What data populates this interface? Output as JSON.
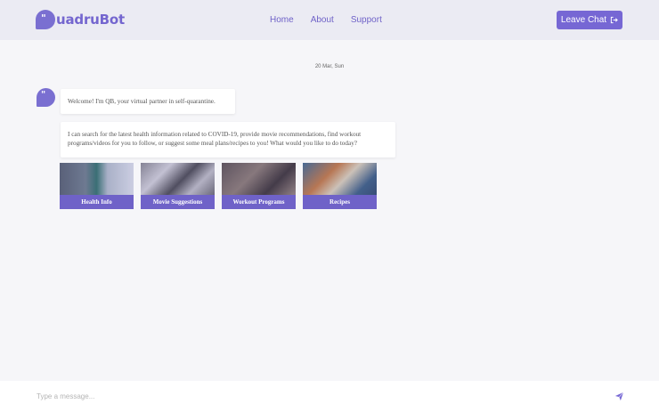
{
  "header": {
    "logo_text": "uadruBot",
    "logo_glyph": "\"",
    "nav": [
      {
        "label": "Home"
      },
      {
        "label": "About"
      },
      {
        "label": "Support"
      }
    ],
    "leave_label": "Leave Chat",
    "leave_icon": "logout-icon"
  },
  "chat": {
    "date": "20 Mar, Sun",
    "avatar_glyph": "\"",
    "messages": [
      {
        "text": "Welcome! I'm QB, your virtual partner in self-quarantine."
      },
      {
        "text": "I can search for the latest health information related to COVID-19, provide movie recommendations, find workout programs/videos for you to follow, or suggest some meal plans/recipes to you! What would you like to do today?"
      }
    ],
    "options": [
      {
        "label": "Health Info"
      },
      {
        "label": "Movie Suggestions"
      },
      {
        "label": "Workout Programs"
      },
      {
        "label": "Recipes"
      }
    ]
  },
  "composer": {
    "placeholder": "Type a message...",
    "send_icon": "send-icon"
  },
  "colors": {
    "accent": "#7667d4",
    "header_bg": "#ebebf3",
    "page_bg": "#f6f6f9"
  }
}
